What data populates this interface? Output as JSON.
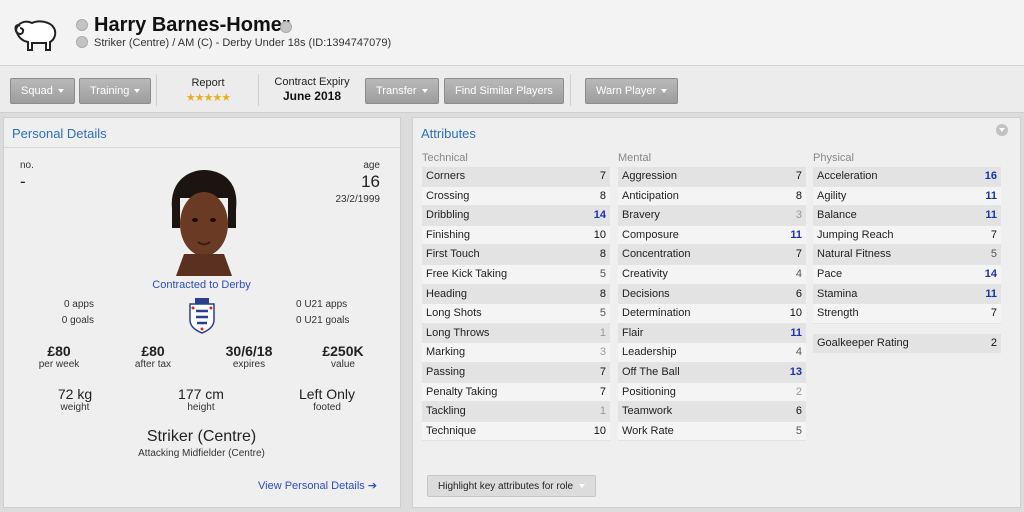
{
  "header": {
    "name": "Harry Barnes-Homer",
    "subtitle": "Striker (Centre) / AM (C) - Derby Under 18s (ID:1394747079)"
  },
  "toolbar": {
    "squad": "Squad",
    "training": "Training",
    "report_label": "Report",
    "report_stars": "★★★★★",
    "report_rating": 4.5,
    "contract_label": "Contract Expiry",
    "contract_value": "June 2018",
    "transfer": "Transfer",
    "find_similar": "Find Similar Players",
    "warn": "Warn Player"
  },
  "personal": {
    "title": "Personal Details",
    "no_label": "no.",
    "no_value": "-",
    "age_label": "age",
    "age_value": "16",
    "dob": "23/2/1999",
    "contract_status": "Contracted to Derby",
    "apps": "0 apps",
    "goals": "0 goals",
    "u21_apps": "0 U21 apps",
    "u21_goals": "0 U21 goals",
    "wage": "£80",
    "wage_label": "per week",
    "after_tax": "£80",
    "after_tax_label": "after tax",
    "expires": "30/6/18",
    "expires_label": "expires",
    "value": "£250K",
    "value_label": "value",
    "weight": "72 kg",
    "weight_label": "weight",
    "height": "177 cm",
    "height_label": "height",
    "footed": "Left Only",
    "footed_label": "footed",
    "position": "Striker (Centre)",
    "position_secondary": "Attacking Midfielder (Centre)",
    "view_link": "View Personal Details ➔"
  },
  "attributes": {
    "title": "Attributes",
    "highlight_button": "Highlight key attributes for role",
    "technical": {
      "header": "Technical",
      "rows": [
        {
          "name": "Corners",
          "value": "7"
        },
        {
          "name": "Crossing",
          "value": "8"
        },
        {
          "name": "Dribbling",
          "value": "14"
        },
        {
          "name": "Finishing",
          "value": "10"
        },
        {
          "name": "First Touch",
          "value": "8"
        },
        {
          "name": "Free Kick Taking",
          "value": "5"
        },
        {
          "name": "Heading",
          "value": "8"
        },
        {
          "name": "Long Shots",
          "value": "5"
        },
        {
          "name": "Long Throws",
          "value": "1"
        },
        {
          "name": "Marking",
          "value": "3"
        },
        {
          "name": "Passing",
          "value": "7"
        },
        {
          "name": "Penalty Taking",
          "value": "7"
        },
        {
          "name": "Tackling",
          "value": "1"
        },
        {
          "name": "Technique",
          "value": "10"
        }
      ]
    },
    "mental": {
      "header": "Mental",
      "rows": [
        {
          "name": "Aggression",
          "value": "7"
        },
        {
          "name": "Anticipation",
          "value": "8"
        },
        {
          "name": "Bravery",
          "value": "3"
        },
        {
          "name": "Composure",
          "value": "11"
        },
        {
          "name": "Concentration",
          "value": "7"
        },
        {
          "name": "Creativity",
          "value": "4"
        },
        {
          "name": "Decisions",
          "value": "6"
        },
        {
          "name": "Determination",
          "value": "10"
        },
        {
          "name": "Flair",
          "value": "11"
        },
        {
          "name": "Leadership",
          "value": "4"
        },
        {
          "name": "Off The Ball",
          "value": "13"
        },
        {
          "name": "Positioning",
          "value": "2"
        },
        {
          "name": "Teamwork",
          "value": "6"
        },
        {
          "name": "Work Rate",
          "value": "5"
        }
      ]
    },
    "physical": {
      "header": "Physical",
      "rows": [
        {
          "name": "Acceleration",
          "value": "16"
        },
        {
          "name": "Agility",
          "value": "11"
        },
        {
          "name": "Balance",
          "value": "11"
        },
        {
          "name": "Jumping Reach",
          "value": "7"
        },
        {
          "name": "Natural Fitness",
          "value": "5"
        },
        {
          "name": "Pace",
          "value": "14"
        },
        {
          "name": "Stamina",
          "value": "11"
        },
        {
          "name": "Strength",
          "value": "7"
        }
      ],
      "gk_name": "Goalkeeper Rating",
      "gk_value": "2"
    }
  },
  "colors": {
    "accent_blue": "#2f6fb8",
    "link_blue": "#2b4dbf",
    "high_attr": "#1a33a6",
    "star_gold": "#e8b020"
  }
}
